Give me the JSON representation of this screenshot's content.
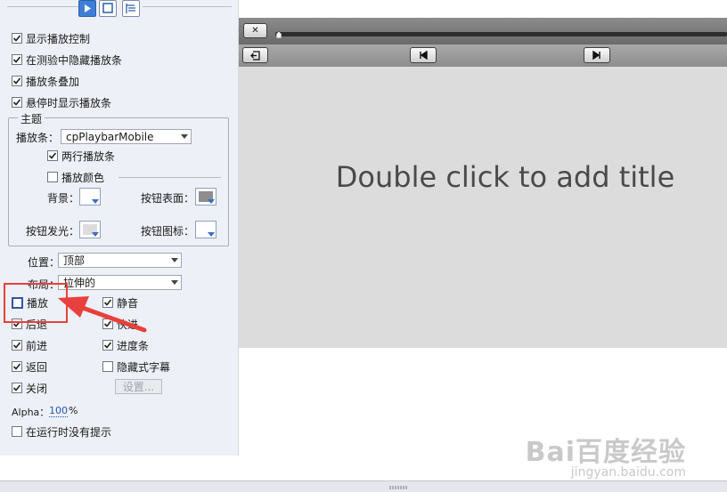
{
  "toolbar": {
    "tabs": [
      {
        "icon": "play-icon",
        "active": true
      },
      {
        "icon": "square-icon",
        "active": false
      },
      {
        "icon": "list-icon",
        "active": false
      }
    ]
  },
  "playback": {
    "show_controls": {
      "label": "显示播放控制",
      "checked": true
    },
    "hide_in_quiz": {
      "label": "在测验中隐藏播放条",
      "checked": true
    },
    "overlay": {
      "label": "播放条叠加",
      "checked": true
    },
    "show_on_hover": {
      "label": "悬停时显示播放条",
      "checked": true
    }
  },
  "theme": {
    "title": "主题",
    "playbar_label": "播放条：",
    "playbar_value": "cpPlaybarMobile",
    "two_row": {
      "label": "两行播放条",
      "checked": true
    },
    "playbar_color": {
      "label": "播放颜色",
      "checked": false
    },
    "background_label": "背景：",
    "button_face_label": "按钮表面：",
    "button_glow_label": "按钮发光：",
    "button_icon_label": "按钮图标："
  },
  "position": {
    "label": "位置：",
    "value": "顶部"
  },
  "layout": {
    "label": "布局：",
    "value": "拉伸的"
  },
  "buttons": {
    "play": {
      "label": "播放",
      "checked": false
    },
    "mute": {
      "label": "静音",
      "checked": true
    },
    "rewind": {
      "label": "后退",
      "checked": true
    },
    "fast_forward": {
      "label": "快进",
      "checked": true
    },
    "forward": {
      "label": "前进",
      "checked": true
    },
    "progress": {
      "label": "进度条",
      "checked": true
    },
    "back": {
      "label": "返回",
      "checked": true
    },
    "closed_captions": {
      "label": "隐藏式字幕",
      "checked": false
    },
    "close": {
      "label": "关闭",
      "checked": true
    },
    "settings_label": "设置..."
  },
  "alpha": {
    "label": "Alpha：",
    "value": "100",
    "unit": "%"
  },
  "no_runtime_tips": {
    "label": "在运行时没有提示",
    "checked": false
  },
  "stage": {
    "slide_title": "Double click to add title",
    "close_symbol": "✕"
  },
  "watermark": {
    "logo": "Bai百度经验",
    "url": "jingyan.baidu.com"
  },
  "colors": {
    "accent": "#3d7fd6",
    "annotation_red": "#e8403c",
    "slide_bg": "#dcdcdc",
    "panel_bg": "#eef0f7"
  }
}
